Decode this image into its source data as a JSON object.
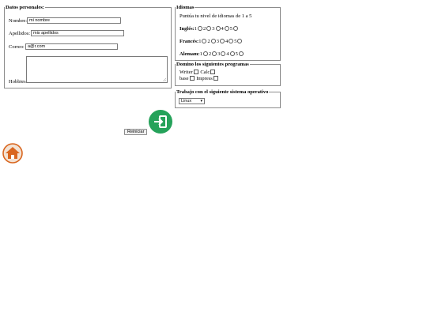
{
  "personal": {
    "legend": "Datos personales:",
    "name_label": "Nombre:",
    "name_value": "mi nombre",
    "surname_label": "Apellidos:",
    "surname_value": "mis apellidos",
    "email_label": "Correo:",
    "email_value": "a@r.com",
    "hobbies_label": "Hobbies"
  },
  "languages": {
    "legend": "Idiomas",
    "intro": "Puntúa tu nivel de idiomas de 1 a 5",
    "rows": [
      {
        "label": "Inglés:",
        "options": [
          "1",
          "2",
          "3",
          "4",
          "5"
        ]
      },
      {
        "label": "Francés:",
        "options": [
          "1",
          "2",
          "3",
          "4",
          "5"
        ]
      },
      {
        "label": "Alemam:",
        "options": [
          "1",
          "2",
          "3",
          "4",
          "5"
        ]
      }
    ]
  },
  "programs": {
    "legend": "Domino los siguientes programas",
    "items": [
      "Writer",
      "Calc",
      "base",
      "Impress"
    ]
  },
  "os": {
    "legend": "Trabajo con el siguiente sistema operativo",
    "selected": "Linux"
  },
  "buttons": {
    "reset_label": "Reiniciar",
    "submit_icon": "enter-icon"
  },
  "colors": {
    "submit_bg": "#25a25a",
    "home_orange": "#d9661f"
  }
}
